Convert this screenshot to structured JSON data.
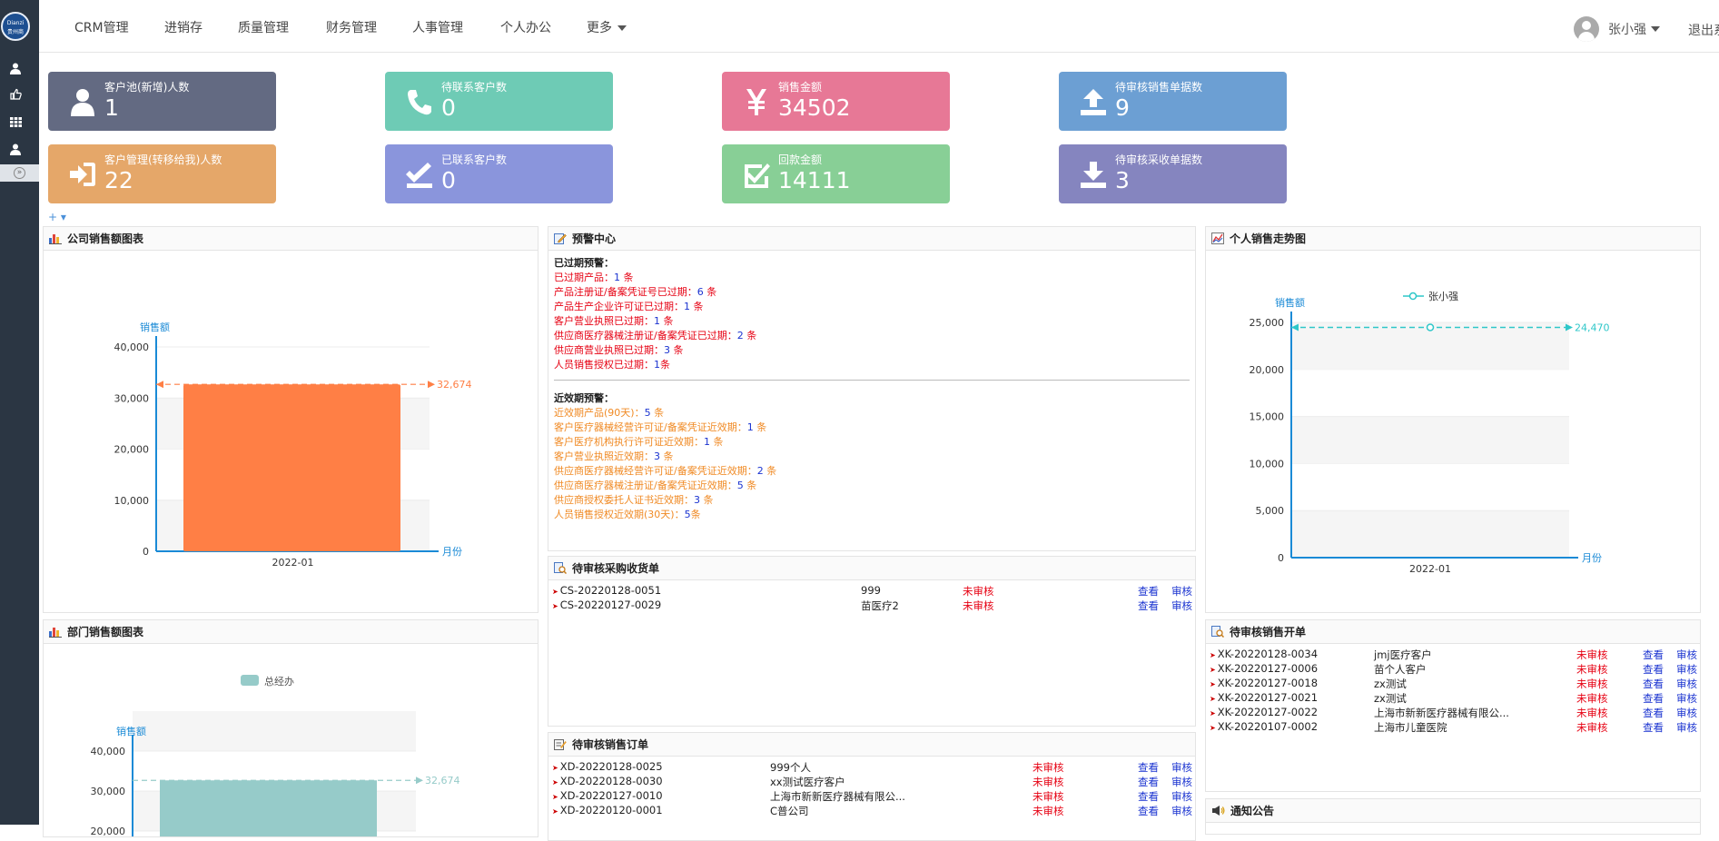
{
  "logo_text": "Dianzi 贵州商",
  "nav": [
    "CRM管理",
    "进销存",
    "质量管理",
    "财务管理",
    "人事管理",
    "个人办公",
    "更多"
  ],
  "user": {
    "name": "张小强",
    "logout": "退出系统"
  },
  "stats": [
    {
      "label": "客户池(新增)人数",
      "value": "1",
      "color": "#636a82",
      "icon": "user-icon"
    },
    {
      "label": "待联系客户数",
      "value": "0",
      "color": "#6ecbb5",
      "icon": "phone-icon"
    },
    {
      "label": "销售金额",
      "value": "34502",
      "color": "#e77896",
      "icon": "yen-icon"
    },
    {
      "label": "待审核销售单据数",
      "value": "9",
      "color": "#6c9fd3",
      "icon": "upload-icon"
    },
    {
      "label": "客户管理(转移给我)人数",
      "value": "22",
      "color": "#e5a769",
      "icon": "signin-icon"
    },
    {
      "label": "已联系客户数",
      "value": "0",
      "color": "#8a95dc",
      "icon": "check-down-icon"
    },
    {
      "label": "回款金额",
      "value": "14111",
      "color": "#88cf96",
      "icon": "checkbox-icon"
    },
    {
      "label": "待审核采收单据数",
      "value": "3",
      "color": "#8585bf",
      "icon": "download-icon"
    }
  ],
  "add_bar": "+ ▾",
  "panels": {
    "company_chart": "公司销售额图表",
    "alert": "预警中心",
    "personal_chart": "个人销售走势图",
    "purchase": "待审核采购收货单",
    "sales_open": "待审核销售开单",
    "dept_chart": "部门销售额图表",
    "sales_order": "待审核销售订单",
    "notice": "通知公告"
  },
  "alerts": {
    "expired_title": "已过期预警：",
    "expired": [
      {
        "t": "已过期产品：",
        "n": "1",
        "u": " 条"
      },
      {
        "t": "产品注册证/备案凭证号已过期：",
        "n": "6",
        "u": " 条"
      },
      {
        "t": "产品生产企业许可证已过期：",
        "n": "1",
        "u": " 条"
      },
      {
        "t": "客户营业执照已过期：",
        "n": "1",
        "u": " 条"
      },
      {
        "t": "供应商医疗器械注册证/备案凭证已过期：",
        "n": "2",
        "u": " 条"
      },
      {
        "t": "供应商营业执照已过期：",
        "n": "3",
        "u": " 条"
      },
      {
        "t": "人员销售授权已过期：",
        "n": "1",
        "u": "条"
      }
    ],
    "near_title": "近效期预警：",
    "near": [
      {
        "t": "近效期产品(90天)：",
        "n": "5",
        "u": " 条"
      },
      {
        "t": "客户医疗器械经营许可证/备案凭证近效期：",
        "n": "1",
        "u": " 条"
      },
      {
        "t": "客户医疗机构执行许可证近效期：",
        "n": "1",
        "u": " 条"
      },
      {
        "t": "客户营业执照近效期：",
        "n": "3",
        "u": " 条"
      },
      {
        "t": "供应商医疗器械经营许可证/备案凭证近效期：",
        "n": "2",
        "u": " 条"
      },
      {
        "t": "供应商医疗器械注册证/备案凭证近效期：",
        "n": "5",
        "u": " 条"
      },
      {
        "t": "供应商授权委托人证书近效期：",
        "n": "3",
        "u": " 条"
      },
      {
        "t": "人员销售授权近效期(30天)：",
        "n": "5",
        "u": "条"
      }
    ]
  },
  "actions": {
    "view": "查看",
    "audit": "审核"
  },
  "purchase_rows": [
    {
      "code": "CS-20220128-0051",
      "name": "999",
      "status": "未审核"
    },
    {
      "code": "CS-20220127-0029",
      "name": "苗医疗2",
      "status": "未审核"
    }
  ],
  "sales_open_rows": [
    {
      "code": "XK-20220128-0034",
      "name": "jmj医疗客户",
      "status": "未审核"
    },
    {
      "code": "XK-20220127-0006",
      "name": "苗个人客户",
      "status": "未审核"
    },
    {
      "code": "XK-20220127-0018",
      "name": "zx测试",
      "status": "未审核"
    },
    {
      "code": "XK-20220127-0021",
      "name": "zx测试",
      "status": "未审核"
    },
    {
      "code": "XK-20220127-0022",
      "name": "上海市新新医疗器械有限公...",
      "status": "未审核"
    },
    {
      "code": "XK-20220107-0002",
      "name": "上海市儿童医院",
      "status": "未审核"
    }
  ],
  "sales_order_rows": [
    {
      "code": "XD-20220128-0025",
      "name": "999个人",
      "status": "未审核"
    },
    {
      "code": "XD-20220128-0030",
      "name": "xx测试医疗客户",
      "status": "未审核"
    },
    {
      "code": "XD-20220127-0010",
      "name": "上海市新新医疗器械有限公...",
      "status": "未审核"
    },
    {
      "code": "XD-20220120-0001",
      "name": "C普公司",
      "status": "未审核"
    }
  ],
  "chart_data": [
    {
      "type": "bar",
      "title": "公司销售额图表",
      "ylabel": "销售额",
      "xlabel": "月份",
      "categories": [
        "2022-01"
      ],
      "values": [
        32674
      ],
      "ylim": [
        0,
        40000
      ],
      "yticks": [
        "0",
        "10,000",
        "20,000",
        "30,000",
        "40,000"
      ],
      "markline_label": "32,674",
      "color": "#ff7f45"
    },
    {
      "type": "line",
      "title": "个人销售走势图",
      "ylabel": "销售额",
      "xlabel": "月份",
      "categories": [
        "2022-01"
      ],
      "series": [
        {
          "name": "张小强",
          "values": [
            24470
          ]
        }
      ],
      "ylim": [
        0,
        25000
      ],
      "yticks": [
        "0",
        "5,000",
        "10,000",
        "15,000",
        "20,000",
        "25,000"
      ],
      "markline_label": "24,470",
      "color": "#2ec7c9"
    },
    {
      "type": "bar",
      "title": "部门销售额图表",
      "ylabel": "销售额",
      "series": [
        {
          "name": "总经办",
          "values": [
            32674
          ]
        }
      ],
      "ylim": [
        0,
        40000
      ],
      "yticks": [
        "20,000",
        "30,000",
        "40,000"
      ],
      "markline_label": "32,674",
      "color": "#96cbc9"
    }
  ]
}
